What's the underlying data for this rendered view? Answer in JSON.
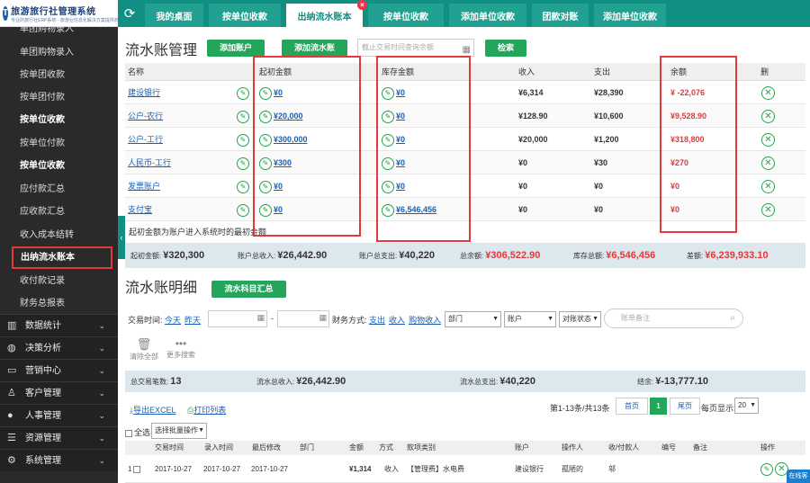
{
  "app": {
    "name": "旅游旅行社管理系统",
    "subtitle": "专业的旅行社ERP系统 · 旅游业信息化解决方案提供商",
    "logo_letter": "T"
  },
  "tabs": [
    {
      "label": "我的桌面"
    },
    {
      "label": "按单位收款"
    },
    {
      "label": "出纳流水账本"
    },
    {
      "label": "按单位收款"
    },
    {
      "label": "添加单位收款"
    },
    {
      "label": "团款对账"
    },
    {
      "label": "添加单位收款"
    }
  ],
  "sidebar": {
    "items": [
      {
        "label": "单团购物录入"
      },
      {
        "label": "按单团收款"
      },
      {
        "label": "按单团付款"
      },
      {
        "label": "按单位收款"
      },
      {
        "label": "按单位付款"
      },
      {
        "label": "按单位收款"
      },
      {
        "label": "应付款汇总"
      },
      {
        "label": "应收款汇总"
      },
      {
        "label": "收入成本结转"
      },
      {
        "label": "出纳流水账本"
      },
      {
        "label": "收付款记录"
      },
      {
        "label": "财务总报表"
      }
    ],
    "top_partial": "单团购物录入",
    "groups": [
      {
        "label": "数据统计"
      },
      {
        "label": "决策分析"
      },
      {
        "label": "营销中心"
      },
      {
        "label": "客户管理"
      },
      {
        "label": "人事管理"
      },
      {
        "label": "资源管理"
      },
      {
        "label": "系统管理"
      }
    ]
  },
  "account": {
    "title": "流水账管理",
    "add_account": "添加账户",
    "add_flow": "添加流水账",
    "search_placeholder": "截止交易时间查询余额",
    "search_btn": "检索",
    "headers": {
      "name": "名称",
      "initial": "起初金额",
      "stock": "库存金额",
      "income": "收入",
      "expense": "支出",
      "balance": "余额",
      "delete": "删"
    },
    "rows": [
      {
        "name": "建设银行",
        "initial": "¥0",
        "stock": "¥0",
        "income": "¥6,314",
        "expense": "¥28,390",
        "balance": "¥ -22,076"
      },
      {
        "name": "公户-农行",
        "initial": "¥20,000",
        "stock": "¥0",
        "income": "¥128.90",
        "expense": "¥10,600",
        "balance": "¥9,528.90"
      },
      {
        "name": "公户-工行",
        "initial": "¥300,000",
        "stock": "¥0",
        "income": "¥20,000",
        "expense": "¥1,200",
        "balance": "¥318,800"
      },
      {
        "name": "人民币-工行",
        "initial": "¥300",
        "stock": "¥0",
        "income": "¥0",
        "expense": "¥30",
        "balance": "¥270"
      },
      {
        "name": "发票账户",
        "initial": "¥0",
        "stock": "¥0",
        "income": "¥0",
        "expense": "¥0",
        "balance": "¥0"
      },
      {
        "name": "支付宝",
        "initial": "¥0",
        "stock": "¥6,546,456",
        "income": "¥0",
        "expense": "¥0",
        "balance": "¥0"
      }
    ],
    "note": "起初金额为账户进入系统时的最初金额",
    "summary": {
      "initial_label": "起初金额:",
      "initial_value": "¥320,300",
      "income_label": "账户总收入:",
      "income_value": "¥26,442.90",
      "expense_label": "账户总支出:",
      "expense_value": "¥40,220",
      "total_label": "总余额:",
      "total_value": "¥306,522.90",
      "stock_label": "库存总额:",
      "stock_value": "¥6,546,456",
      "diff_label": "差额:",
      "diff_value": "¥6,239,933.10"
    }
  },
  "ledger": {
    "title": "流水账明细",
    "subject_btn": "流水科目汇总",
    "time_label": "交易时间:",
    "time_links": [
      "今天",
      "昨天"
    ],
    "date_dash": "-",
    "method_label": "财务方式:",
    "method_links": [
      "支出",
      "收入",
      "购物收入"
    ],
    "selects": [
      "部门",
      "账户",
      "对账状态"
    ],
    "note_placeholder": "账单备注",
    "clear_label": "清除全部",
    "more_label": "更多搜索",
    "totals": {
      "count_label": "总交易笔数:",
      "count_value": "13",
      "income_label": "流水总收入:",
      "income_value": "¥26,442.90",
      "expense_label": "流水总支出:",
      "expense_value": "¥40,220",
      "balance_label": "结余:",
      "balance_value": "¥-13,777.10"
    },
    "export_excel": "导出EXCEL",
    "print_list": "打印列表",
    "page_info": "第1-13条/共13条",
    "pager": {
      "first": "首页",
      "current": "1",
      "last": "尾页",
      "per_page_label": "每页显示:",
      "per_page": "20"
    },
    "select_all": "全选",
    "batch": "选择批量操作",
    "headers": [
      "交易时间",
      "录入时间",
      "最后修改",
      "部门",
      "金额",
      "方式",
      "款项类别",
      "账户",
      "操作人",
      "收/付款人",
      "编号",
      "备注",
      "操作"
    ],
    "rows": [
      {
        "idx": "1",
        "trade": "2017-10-27",
        "entry": "2017-10-27",
        "modified": "2017-10-27",
        "dept": "",
        "amount": "¥1,314",
        "method": "收入",
        "category": "【管理费】水电费",
        "account": "建设银行",
        "operator": "孤陋的",
        "payer": "邬",
        "number": "",
        "remark": ""
      }
    ]
  },
  "online": "在线客服"
}
